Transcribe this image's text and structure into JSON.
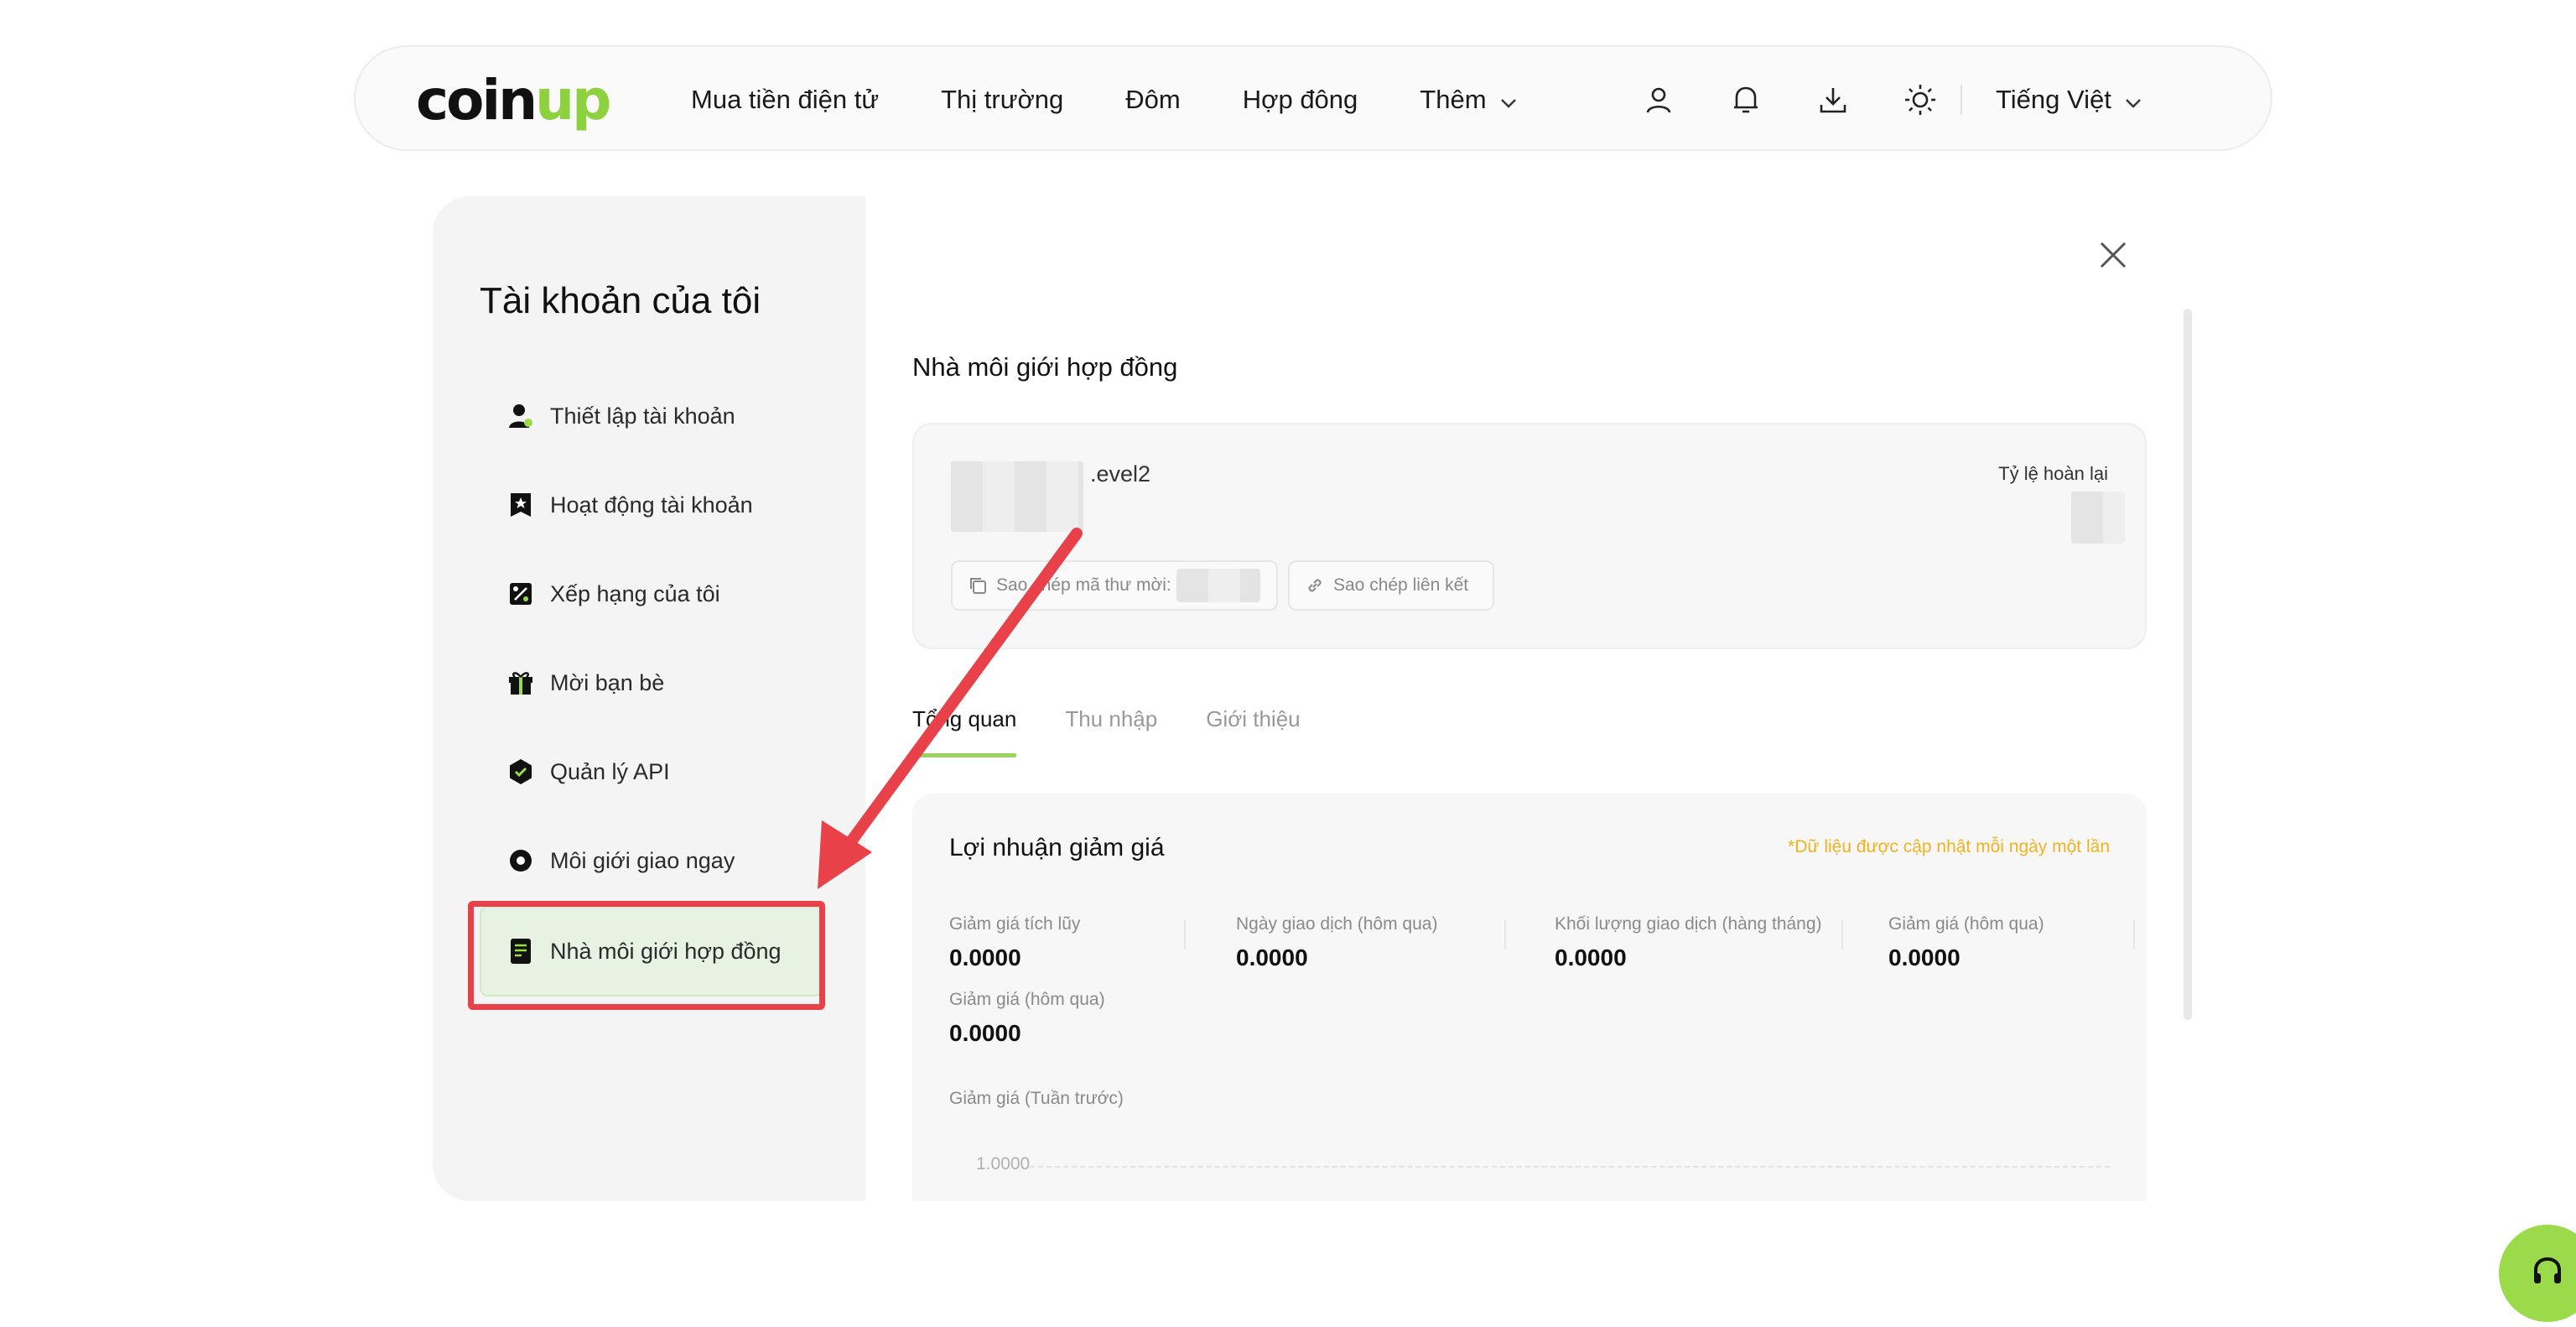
{
  "brand": {
    "logo_prefix": "coin",
    "logo_suffix": "up",
    "accent": "#9bdb4b"
  },
  "nav": {
    "links": [
      "Mua tiền điện tử",
      "Thị trường",
      "Đôm",
      "Hợp đông",
      "Thêm"
    ],
    "icons": [
      "user-icon",
      "bell-icon",
      "download-icon",
      "sun-icon"
    ],
    "language": "Tiếng Việt"
  },
  "sidebar": {
    "title": "Tài khoản của tôi",
    "items": [
      {
        "label": "Thiết lập tài khoản",
        "icon": "user-settings-icon"
      },
      {
        "label": "Hoạt động tài khoản",
        "icon": "activity-icon"
      },
      {
        "label": "Xếp hạng của tôi",
        "icon": "percent-badge-icon"
      },
      {
        "label": "Mời bạn bè",
        "icon": "gift-icon"
      },
      {
        "label": "Quản lý API",
        "icon": "api-hexagon-icon"
      },
      {
        "label": "Môi giới giao ngay",
        "icon": "spot-broker-icon"
      },
      {
        "label": "Nhà môi giới hợp đồng",
        "icon": "contract-doc-icon"
      }
    ],
    "active_index": 6
  },
  "main": {
    "title": "Nhà môi giới hợp đồng",
    "level_suffix": ".evel2",
    "rebate_rate_label": "Tỷ lệ hoàn lại",
    "copy_code_label": "Sao chép mã thư mời:",
    "copy_link_label": "Sao chép liên kết",
    "tabs": [
      "Tổng quan",
      "Thu nhập",
      "Giới thiệu"
    ],
    "active_tab": 0,
    "profit": {
      "title": "Lợi nhuận giảm giá",
      "note": "*Dữ liệu được cập nhật mỗi ngày một lần",
      "stats": [
        {
          "label": "Giảm giá tích lũy",
          "value": "0.0000"
        },
        {
          "label": "Ngày giao dịch (hôm qua)",
          "value": "0.0000"
        },
        {
          "label": "Khối lượng giao dịch (hàng tháng)",
          "value": "0.0000"
        },
        {
          "label": "Giảm giá (hôm qua)",
          "value": "0.0000"
        },
        {
          "label": "Giảm giá (hôm qua)",
          "value": "0.0000"
        }
      ],
      "chart_label": "Giảm giá (Tuần trước)",
      "chart_y_tick": "1.0000"
    }
  }
}
